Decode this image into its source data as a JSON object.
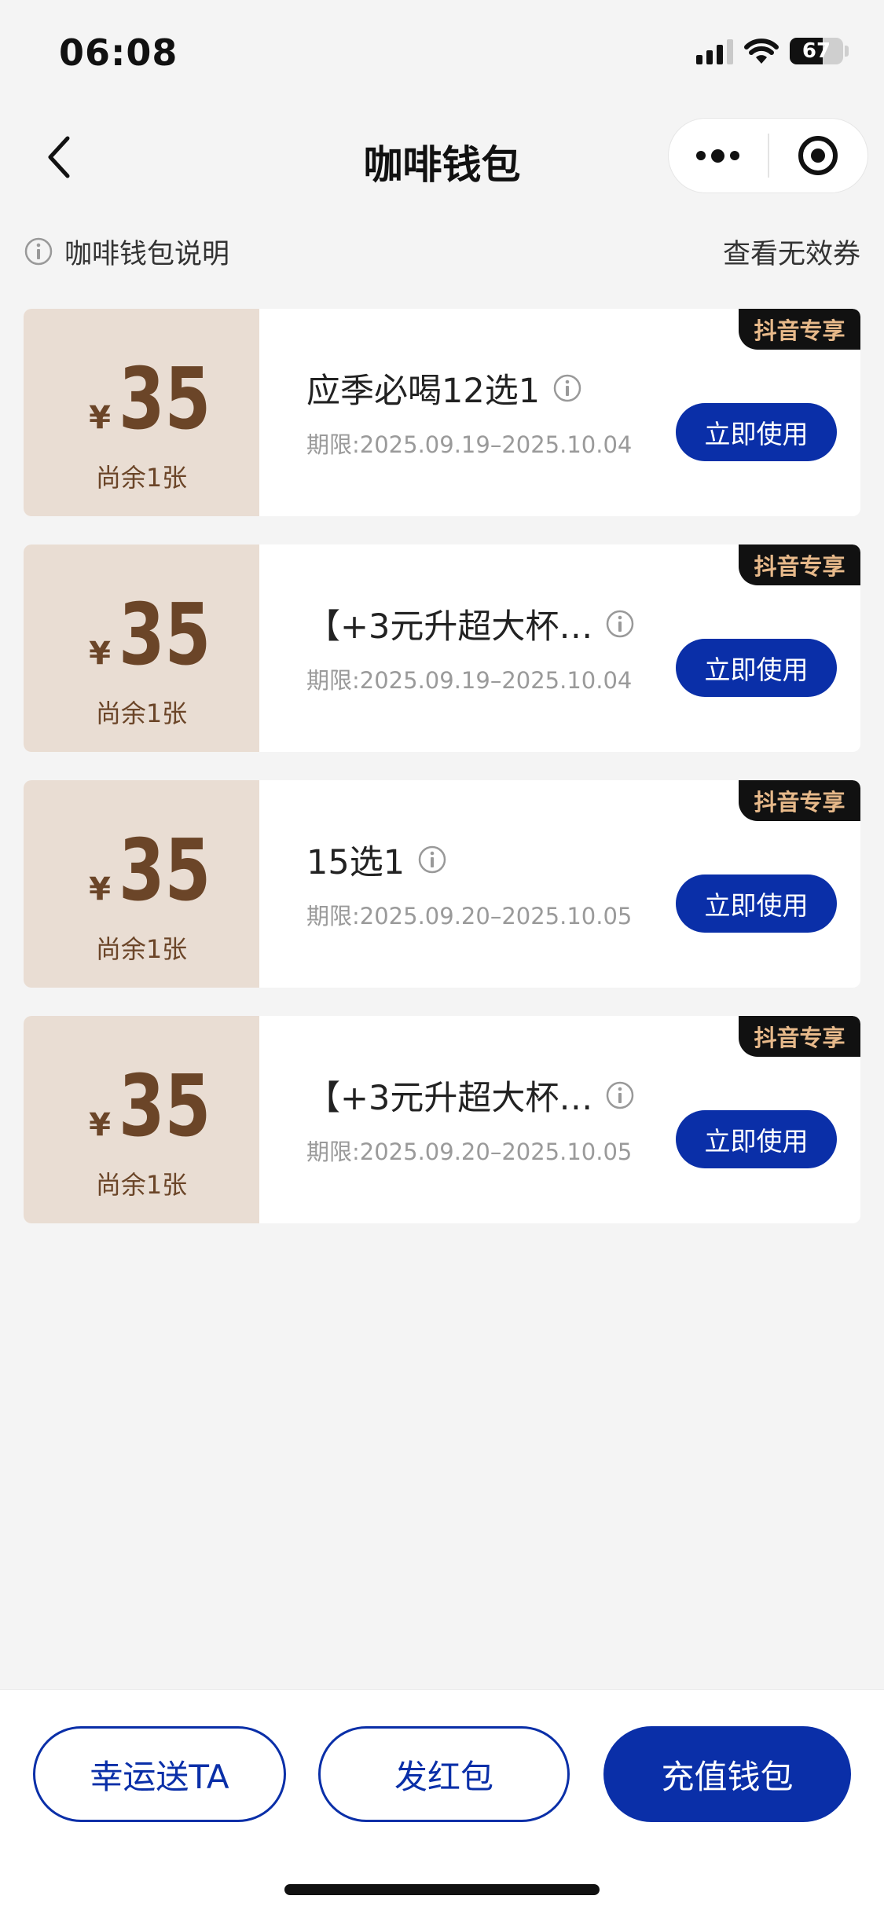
{
  "status_bar": {
    "time": "06:08",
    "battery": "67"
  },
  "nav": {
    "title": "咖啡钱包",
    "back_icon": "chevron-left-icon",
    "more_icon": "more-dots-icon",
    "close_icon": "target-circle-icon"
  },
  "help": {
    "label": "咖啡钱包说明",
    "invalid_link": "查看无效券"
  },
  "coupons": [
    {
      "currency": "¥",
      "amount": "35",
      "remaining": "尚余1张",
      "name": "应季必喝12选1",
      "validity": "期限:2025.09.19–2025.10.04",
      "button": "立即使用",
      "tag": "抖音专享"
    },
    {
      "currency": "¥",
      "amount": "35",
      "remaining": "尚余1张",
      "name": "【+3元升超大杯…",
      "validity": "期限:2025.09.19–2025.10.04",
      "button": "立即使用",
      "tag": "抖音专享"
    },
    {
      "currency": "¥",
      "amount": "35",
      "remaining": "尚余1张",
      "name": "15选1",
      "validity": "期限:2025.09.20–2025.10.05",
      "button": "立即使用",
      "tag": "抖音专享"
    },
    {
      "currency": "¥",
      "amount": "35",
      "remaining": "尚余1张",
      "name": "【+3元升超大杯…",
      "validity": "期限:2025.09.20–2025.10.05",
      "button": "立即使用",
      "tag": "抖音专享"
    }
  ],
  "bottom": {
    "lucky": "幸运送TA",
    "red_packet": "发红包",
    "recharge": "充值钱包"
  },
  "colors": {
    "accent": "#0a2fa8",
    "coupon_left_bg": "#e9ddd3",
    "price": "#6b4528",
    "tag_text": "#e7b98a"
  }
}
